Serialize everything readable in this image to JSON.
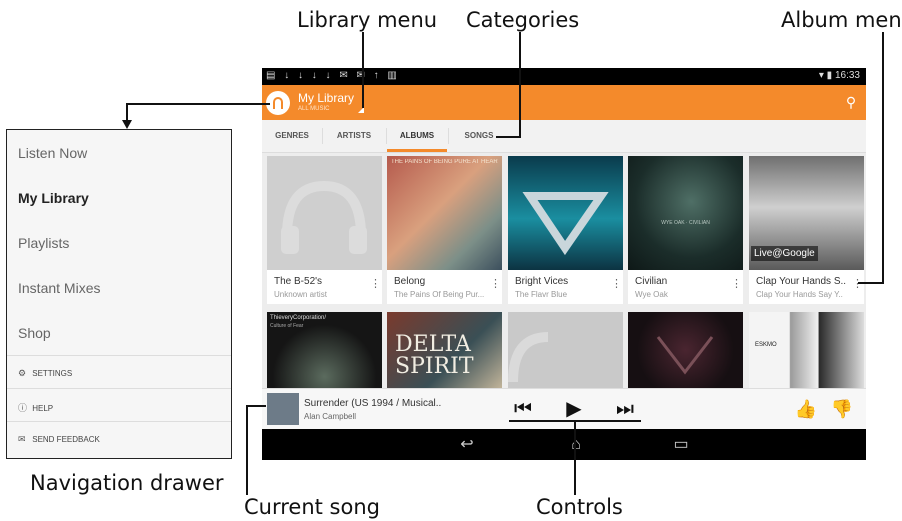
{
  "callouts": {
    "library_menu": "Library menu",
    "categories": "Categories",
    "album_menu": "Album menu",
    "navigation_drawer": "Navigation drawer",
    "current_song": "Current song",
    "controls": "Controls"
  },
  "status_bar": {
    "time": "16:33",
    "notification_icons": "▤ ↓ ↓ ↓ ↓ ✉ ✉ ↑ ▥",
    "system_icons": "▾ ▮"
  },
  "action_bar": {
    "title": "My Library",
    "subtitle": "ALL MUSIC",
    "search_icon": "search-icon",
    "accent": "#f48a2b"
  },
  "tabs": [
    {
      "label": "GENRES"
    },
    {
      "label": "ARTISTS"
    },
    {
      "label": "ALBUMS",
      "active": true
    },
    {
      "label": "SONGS"
    }
  ],
  "albums": [
    {
      "title": "The B-52's",
      "artist": "Unknown artist"
    },
    {
      "title": "Belong",
      "artist": "The Pains Of Being Pur..."
    },
    {
      "title": "Bright Vices",
      "artist": "The Flavr Blue"
    },
    {
      "title": "Civilian",
      "artist": "Wye Oak"
    },
    {
      "title": "Clap Your Hands S..",
      "artist": "Clap Your Hands Say Y..",
      "art_text": "Live@Google"
    }
  ],
  "album_art_text": {
    "belong": "THE PAINS OF BEING PURE AT HEART · BELONG",
    "civilian": "WYE OAK · CIVILIAN",
    "thievery": "ThieveryCorporation/",
    "thievery_sub": "Culture of Fear",
    "delta": "DELTA SPIRIT",
    "eskmo": "ESKMO"
  },
  "now_playing": {
    "title": "Surrender (US 1994 / Musical..",
    "artist": "Alan Campbell"
  },
  "controls": {
    "prev": "⏮",
    "play": "▶",
    "next": "⏭",
    "thumbs_up": "👍",
    "thumbs_down": "👎"
  },
  "nav_bar": {
    "back": "↩",
    "home": "⌂",
    "recents": "▭"
  },
  "drawer": {
    "items": [
      {
        "label": "Listen Now"
      },
      {
        "label": "My Library",
        "active": true
      },
      {
        "label": "Playlists"
      },
      {
        "label": "Instant Mixes"
      },
      {
        "label": "Shop"
      }
    ],
    "settings": "SETTINGS",
    "help": "HELP",
    "feedback": "SEND FEEDBACK"
  }
}
